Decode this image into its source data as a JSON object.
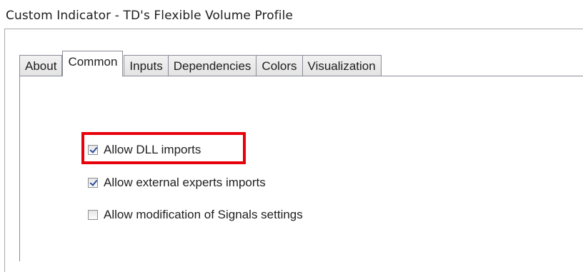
{
  "window": {
    "title": "Custom Indicator - TD's Flexible Volume Profile"
  },
  "tabs": [
    {
      "label": "About",
      "active": false
    },
    {
      "label": "Common",
      "active": true
    },
    {
      "label": "Inputs",
      "active": false
    },
    {
      "label": "Dependencies",
      "active": false
    },
    {
      "label": "Colors",
      "active": false
    },
    {
      "label": "Visualization",
      "active": false
    }
  ],
  "options": [
    {
      "label": "Allow DLL imports",
      "checked": true,
      "highlighted": true
    },
    {
      "label": "Allow external experts imports",
      "checked": true,
      "highlighted": false
    },
    {
      "label": "Allow modification of Signals settings",
      "checked": false,
      "highlighted": false
    }
  ],
  "colors": {
    "highlight": "#e8000b",
    "check_mark": "#2d4f9e"
  }
}
